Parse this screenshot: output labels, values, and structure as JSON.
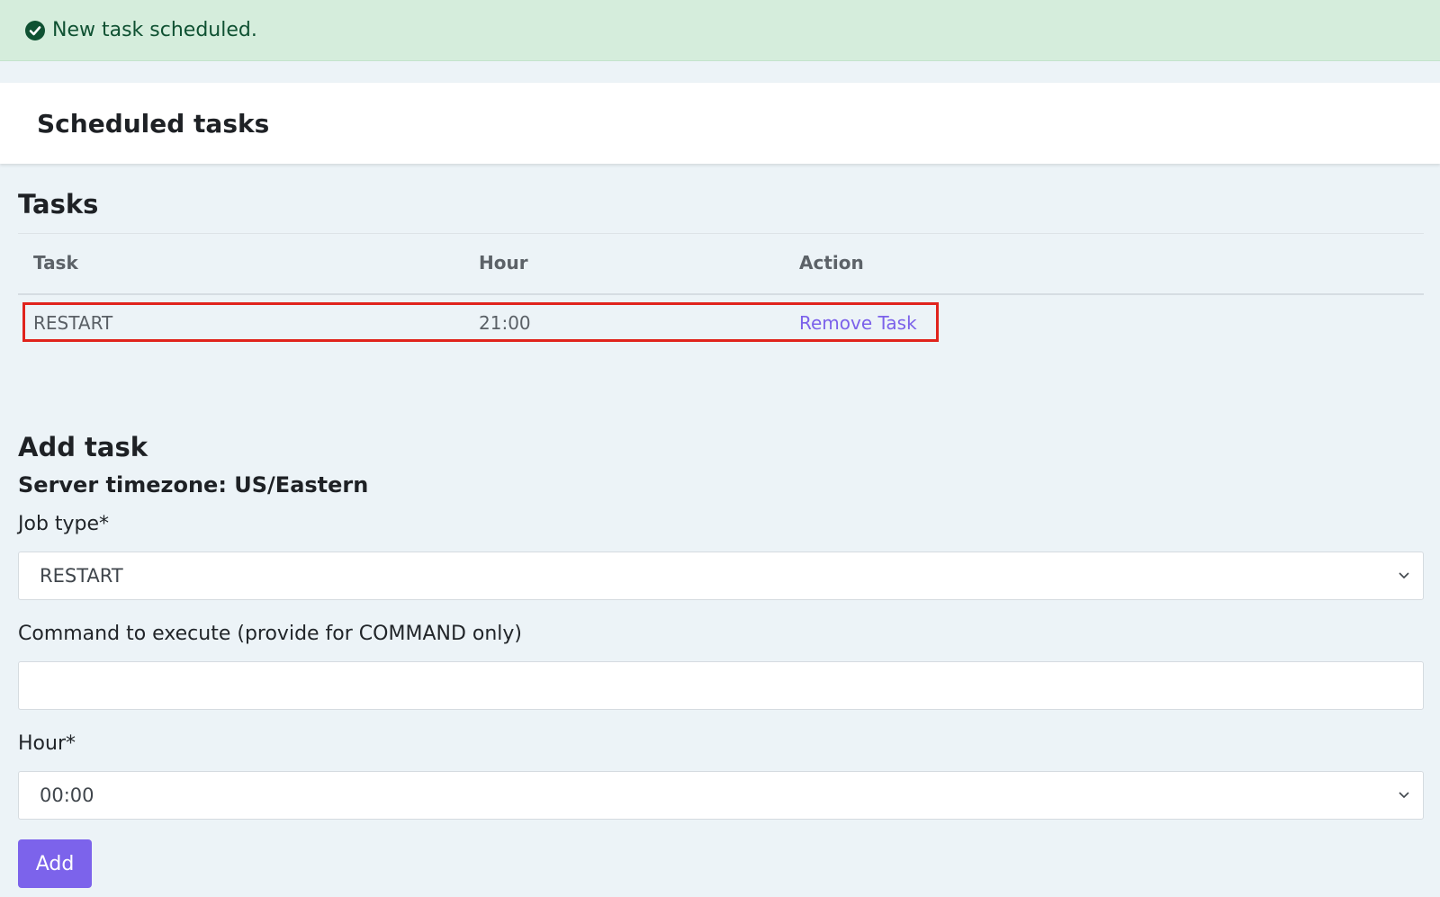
{
  "alert": {
    "icon": "check-circle-icon",
    "message": "New task scheduled."
  },
  "header": {
    "title": "Scheduled tasks"
  },
  "tasks": {
    "heading": "Tasks",
    "columns": [
      "Task",
      "Hour",
      "Action"
    ],
    "rows": [
      {
        "task": "RESTART",
        "hour": "21:00",
        "action": "Remove Task"
      }
    ]
  },
  "add_task": {
    "heading": "Add task",
    "timezone": "Server timezone: US/Eastern",
    "job_type": {
      "label": "Job type*",
      "value": "RESTART"
    },
    "command": {
      "label": "Command to execute (provide for COMMAND only)",
      "value": ""
    },
    "hour": {
      "label": "Hour*",
      "value": "00:00"
    },
    "submit_label": "Add"
  },
  "colors": {
    "alert_bg": "#d5eddc",
    "alert_text": "#0f5132",
    "link": "#7b61ea",
    "button": "#7c63eb",
    "highlight": "#e0231c"
  }
}
